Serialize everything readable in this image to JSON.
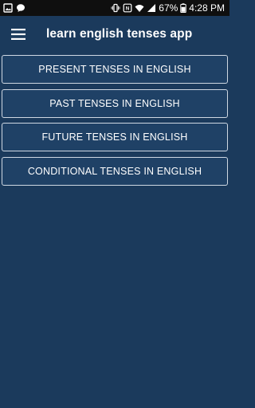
{
  "status_bar": {
    "battery": "67%",
    "time": "4:28 PM"
  },
  "app_bar": {
    "title": "learn english tenses app",
    "menu_icon": "hamburger-menu-icon"
  },
  "menu_items": [
    {
      "label": "PRESENT TENSES IN ENGLISH"
    },
    {
      "label": "PAST TENSES IN ENGLISH"
    },
    {
      "label": "FUTURE TENSES IN ENGLISH"
    },
    {
      "label": "CONDITIONAL TENSES IN ENGLISH"
    }
  ],
  "colors": {
    "background": "#1b3a5c",
    "button_bg": "#1f4166",
    "button_border": "#cfd8e3",
    "status_bar": "#0f0f0f"
  }
}
